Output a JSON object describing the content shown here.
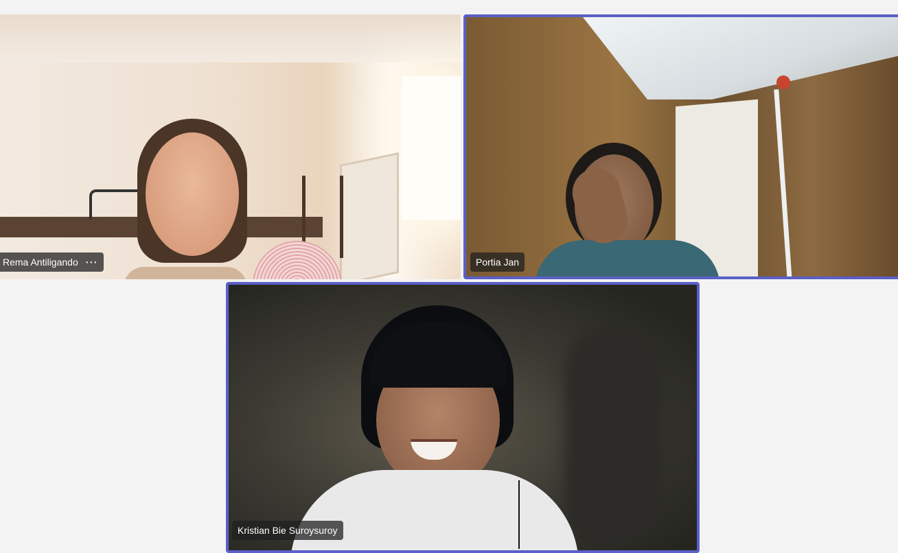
{
  "participants": [
    {
      "name": "Rema Antiligando",
      "more_icon": "⋯",
      "active_speaker": false
    },
    {
      "name": "Portia Jan",
      "active_speaker": true
    },
    {
      "name": "Kristian Bie Suroysuroy",
      "active_speaker": true
    }
  ],
  "colors": {
    "background": "#f3f3f3",
    "active_border": "#5b5fc7",
    "name_tag_bg": "rgba(32,32,32,0.75)"
  },
  "icons": {
    "more_options": "more-horizontal-icon"
  }
}
